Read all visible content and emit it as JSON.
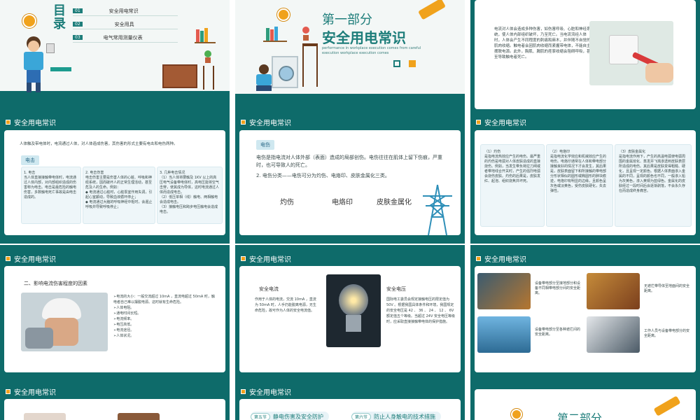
{
  "colors": {
    "teal": "#0e6b6a",
    "accent": "#f0a21c",
    "panel": "#ffffff",
    "light_blue": "#cfe8f0"
  },
  "toc": {
    "title_chars": [
      "目",
      "录"
    ],
    "items": [
      {
        "num": "01",
        "label": "安全用电常识"
      },
      {
        "num": "02",
        "label": "安全用具"
      },
      {
        "num": "03",
        "label": "电气常用测量仪表"
      }
    ]
  },
  "part1": {
    "heading": "第一部分",
    "title": "安全用电常识",
    "subtitle_line1": "performance in workplace execution comes from careful",
    "subtitle_line2": "execution workplace execution comes"
  },
  "intro": {
    "paragraph": "电流对人体会造成多种伤害，如伤害呼吸、心脏和神经系统，使人体内部组织破坏，乃至死亡。当电流流经人体时，人体会产生不同程度的刺痛和麻木，并伴随不自觉的肌肉收缩。触电者会因肌肉收缩而紧握带电体，不能自主摆脱电源。此外，胸肌、膈肌的痉挛收缩会阻碍呼吸，甚至导致触电者死亡。"
  },
  "section_label": "安全用电常识",
  "electric_shock": {
    "intro": "人体触及带电体时，电流通过人体，对人体造成伤害，其伤害的形式主要有电击和电伤两种。",
    "tab": "电击",
    "col1": "1. 电击\n当人体直接接触带电体时，电流通过人体内部，对内部组织造成的伤害称为电击。电击是最危险的触电伤害，多数触电死亡事故是由电击造成的。",
    "col2": "2. 电击伤害\n电击伤害主要是伤害人体的心脏、呼吸和神经系统，因而破坏人的正常生理活动，甚至危及人的生命。例如：\n◆ 电流通过心脏时，心脏泵室作用失调，引起心室颤动，导致血液循环停止；\n◆ 电流通过大脑的呼吸神经中枢时，会遏止呼吸并导致呼吸停止；",
    "col3": "3. 几种电击情况\n（1）当人体将要触及 1KV 以上的高压电气设备带电体时，高电压能将空气击穿，使其成为导体，这时电流通过人体而造成电击。\n（2）低压单相（线）触电、两相触电会造成电击。\n（3）接触电压和跨步电压触电会造成电击。"
  },
  "electric_injury": {
    "tab": "电伤",
    "para1": "电伤是指电流对人体外部（表面）造成的局部创伤。电伤往往在肌体上留下伤痕，严重时，也可导致人的死亡。",
    "para2": "2. 电伤分类——电伤可分为灼伤、电烙印、皮肤金属化三类。",
    "types": [
      "灼伤",
      "电烙印",
      "皮肤金属化"
    ]
  },
  "injury_types": {
    "c1": "（1）灼伤\n是指电流热效应产生的电伤。最严重的灼伤是电弧对人体皮肤造成的直接烧伤。例如，当发生带负荷拉刀闸或者带地线合开关时，产生的强烈电弧会烧伤皮肤。灼伤的后果是，皮肤发红、起泡、组织烧焦并坏死。",
    "c2": "（2）电烙印\n是指电流化学效应和机械效应产生的电伤。电烙印通常在人体和带电部分接触良好的情况下才会发生，其后果是，皮肤表面留下和所接触的带电部分形状相似的圆形或椭圆形的肿块痕迹，电烙印有明显的边缘，且颜色呈灰色或淡黄色，受伤皮肤硬化，失去弹性。",
    "c3": "（3）皮肤金属化\n是指电流作用下，产生的高温电弧使电弧周围的金属熔化、蒸发并飞溅渗透到皮肤表层所造成的电伤。其后果是皮肤变得粗糙、硬化，且呈现一定颜色。根据人体表面渗入金属的不同，呈现的颜色也不同，一般渗入铅为灰黄色，渗入黄铜为蓝绿色。金属化的皮肤经过一段时间后会逐渐剥落，不会永久存在而造成终身痛苦。"
  },
  "factors": {
    "title": "二、影响电流伤害程度的因素",
    "list": "➢电流的大小：一般交流超过 10mA ，直流电超过 50mA 时，触电者自己难以摆脱电源。这时就有生命危险。\n➢人体电阻。\n➢通电时间长短。\n➢电流频率。\n➢电压高低。\n➢电流途径。\n➢人体状况。"
  },
  "current_voltage": {
    "h1": "安全电流",
    "p1": "作用于人体的电流，交流 10mA ，直流为 50mA 时，人手仍能脱离电源，无生命危险，故可作为人体的安全电流值。",
    "h2": "安全电压",
    "p2": "国际电工委员会规定接触电压的限定值为 50V 。根据我国具体条件和环境，我国规定的安全电压是 42 、 36 、 24 、 12 、 6V 额定值五个等级。当超过 24V 安全电压等级时，应采取直接接触带电体的保护措施。"
  },
  "equipment": {
    "t1": "设备带电部分至接地部分和设备不同相带电部分间的安全距离。",
    "t2": "无遮拦带导体至地面间的安全距离。",
    "t3": "设备带电部分至各种遮拦间的安全距离。",
    "t4": "工作人员与设备带电部分的安全距离。"
  },
  "sections": {
    "s5_num": "第五节",
    "s5_label": "静电伤害及安全防护",
    "s6_num": "第六节",
    "s6_label": "防止人身触电的技术措施"
  },
  "part2": {
    "heading": "第二部分"
  }
}
